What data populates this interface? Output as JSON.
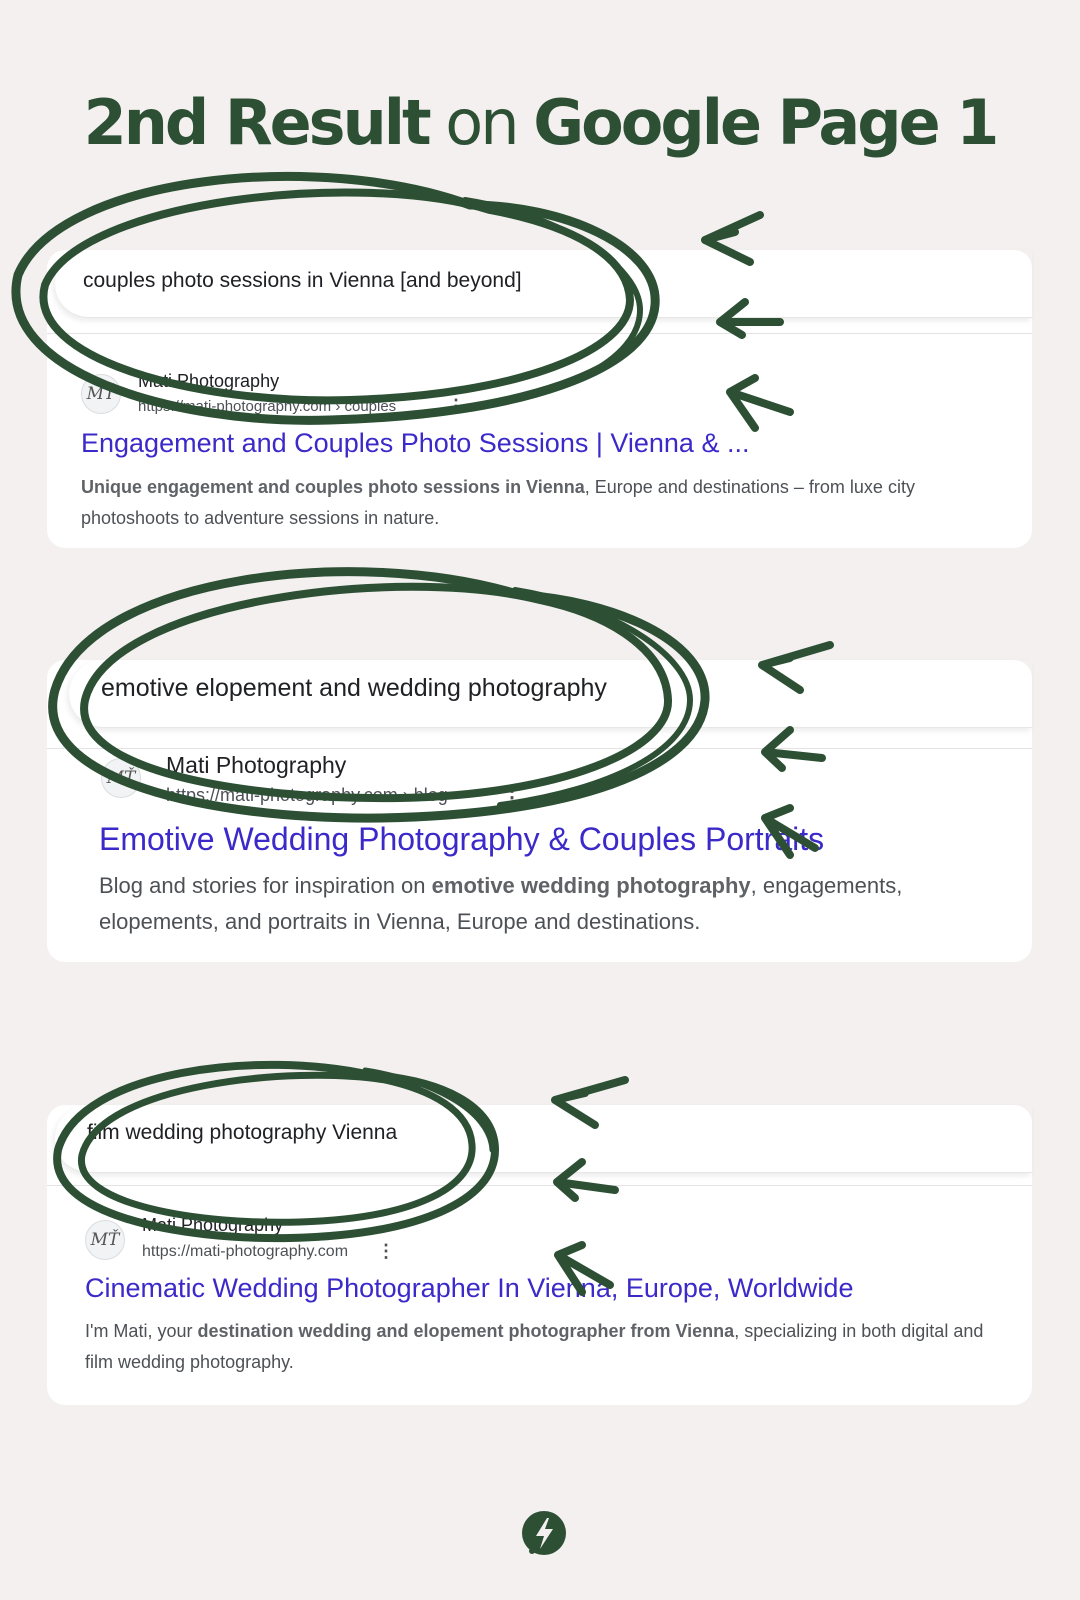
{
  "headline": {
    "part1": "2nd Result",
    "part2": " on ",
    "part3": "Google Page 1"
  },
  "colors": {
    "ink_green": "#2d5035",
    "link_purple": "#3b29c9",
    "background": "#f3f0ef"
  },
  "results": [
    {
      "query": "couples photo sessions in Vienna [and beyond]",
      "site_name": "Mati Photography",
      "url": "https://mati-photography.com › couples",
      "title": "Engagement and Couples Photo Sessions | Vienna & ...",
      "snippet_bold": "Unique engagement and couples photo sessions in Vienna",
      "snippet_rest": ", Europe and destinations – from luxe city photoshoots to adventure sessions in nature."
    },
    {
      "query": "emotive elopement and wedding photography",
      "site_name": "Mati Photography",
      "url": "https://mati-photography.com › blog",
      "title": "Emotive Wedding Photography & Couples Portraits",
      "snippet_pre": "Blog and stories for inspiration on ",
      "snippet_bold": "emotive wedding photography",
      "snippet_rest": ", engagements, elopements, and portraits in Vienna, Europe and destinations."
    },
    {
      "query": "film wedding photography Vienna",
      "site_name": "Mati Photography",
      "url": "https://mati-photography.com",
      "title": "Cinematic Wedding Photographer In Vienna, Europe, Worldwide",
      "snippet_pre": "I'm Mati, your ",
      "snippet_bold": "destination wedding and elopement photographer from Vienna",
      "snippet_rest": ", specializing in both digital and film wedding photography."
    }
  ],
  "icons": {
    "favicon": "monogram-favicon-icon",
    "more": "kebab-menu-icon",
    "brand": "lightning-bolt-logo-icon"
  },
  "kebab_glyph": "⋮",
  "favicon_glyph": "MŤ"
}
